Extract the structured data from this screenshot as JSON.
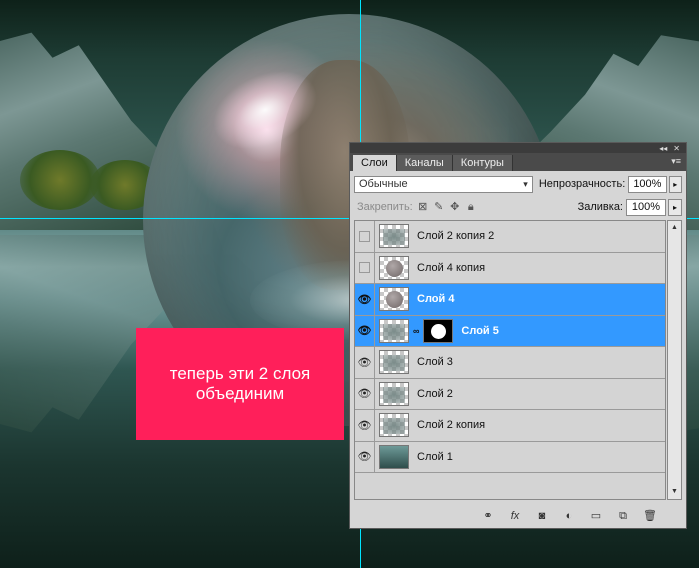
{
  "callout": {
    "text": "теперь эти 2 слоя\nобъединим"
  },
  "panel": {
    "header_icons": [
      "collapse-icon",
      "close-icon"
    ],
    "tabs": [
      {
        "label": "Слои",
        "active": true
      },
      {
        "label": "Каналы",
        "active": false
      },
      {
        "label": "Контуры",
        "active": false
      }
    ],
    "blend_mode": "Обычные",
    "opacity_label": "Непрозрачность:",
    "opacity_value": "100%",
    "lock_label": "Закрепить:",
    "fill_label": "Заливка:",
    "fill_value": "100%",
    "layers": [
      {
        "name": "Слой 2 копия 2",
        "visible": false,
        "selected": false,
        "thumb": "texture"
      },
      {
        "name": "Слой 4 копия",
        "visible": false,
        "selected": false,
        "thumb": "sphere"
      },
      {
        "name": "Слой 4",
        "visible": true,
        "selected": true,
        "thumb": "sphere"
      },
      {
        "name": "Слой 5",
        "visible": true,
        "selected": true,
        "thumb": "texture",
        "has_mask": true
      },
      {
        "name": "Слой 3",
        "visible": true,
        "selected": false,
        "thumb": "texture"
      },
      {
        "name": "Слой 2",
        "visible": true,
        "selected": false,
        "thumb": "texture"
      },
      {
        "name": "Слой 2 копия",
        "visible": true,
        "selected": false,
        "thumb": "texture"
      },
      {
        "name": "Слой 1",
        "visible": true,
        "selected": false,
        "thumb": "solid"
      }
    ],
    "footer_icons": [
      "link-layers-icon",
      "fx-icon",
      "add-mask-icon",
      "adjustment-layer-icon",
      "new-group-icon",
      "new-layer-icon",
      "trash-icon"
    ]
  },
  "colors": {
    "selection": "#3399ff",
    "callout": "#ff1f5a",
    "guides": "#00e5ff"
  }
}
